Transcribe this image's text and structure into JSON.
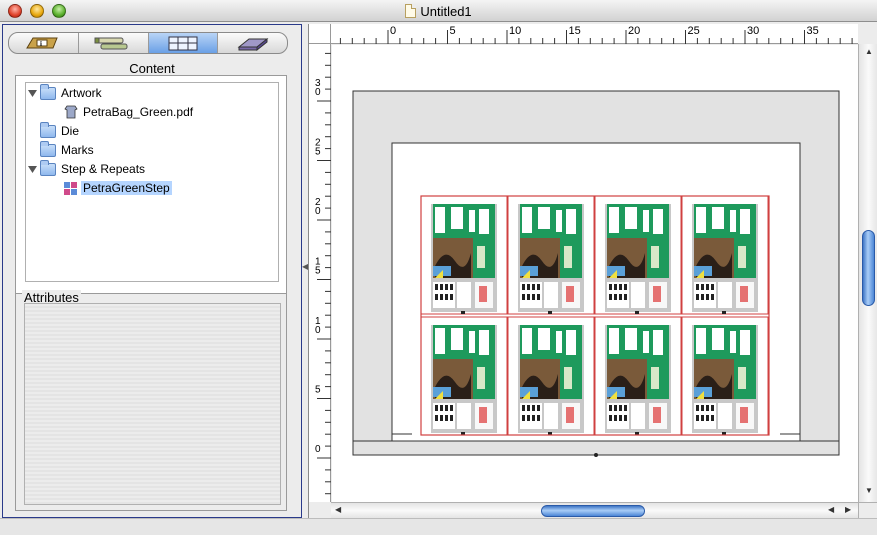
{
  "window": {
    "title": "Untitled1"
  },
  "left_panel": {
    "tabs": [
      {
        "name": "info-tab",
        "icon": "info-icon"
      },
      {
        "name": "resources-tab",
        "icon": "tubes-icon"
      },
      {
        "name": "layout-tab",
        "icon": "grid-icon",
        "selected": true
      },
      {
        "name": "output-tab",
        "icon": "stack-icon"
      }
    ],
    "content_title": "Content",
    "tree": [
      {
        "label": "Artwork",
        "expanded": true,
        "children": [
          {
            "label": "PetraBag_Green.pdf"
          }
        ]
      },
      {
        "label": "Die"
      },
      {
        "label": "Marks"
      },
      {
        "label": "Step & Repeats",
        "expanded": true,
        "children": [
          {
            "label": "PetraGreenStep",
            "selected": true
          }
        ]
      }
    ],
    "attributes_title": "Attributes"
  },
  "rulers": {
    "horizontal_labels": [
      "0",
      "5",
      "10",
      "15",
      "20",
      "25",
      "30",
      "35"
    ],
    "vertical_labels": [
      "3\n0",
      "2\n5",
      "2\n0",
      "1\n5",
      "1\n0",
      "5",
      "0",
      "5"
    ]
  },
  "colors": {
    "selection": "#b5d5ff",
    "label_green": "#1e9a5c",
    "trim_red": "#d04040",
    "scroll_blue": "#4c86d6"
  },
  "layout": {
    "grid": {
      "rows": 2,
      "cols": 4
    },
    "label_texts": [
      "Sinai",
      "5",
      "tein",
      "PURE",
      "Kodak"
    ]
  }
}
